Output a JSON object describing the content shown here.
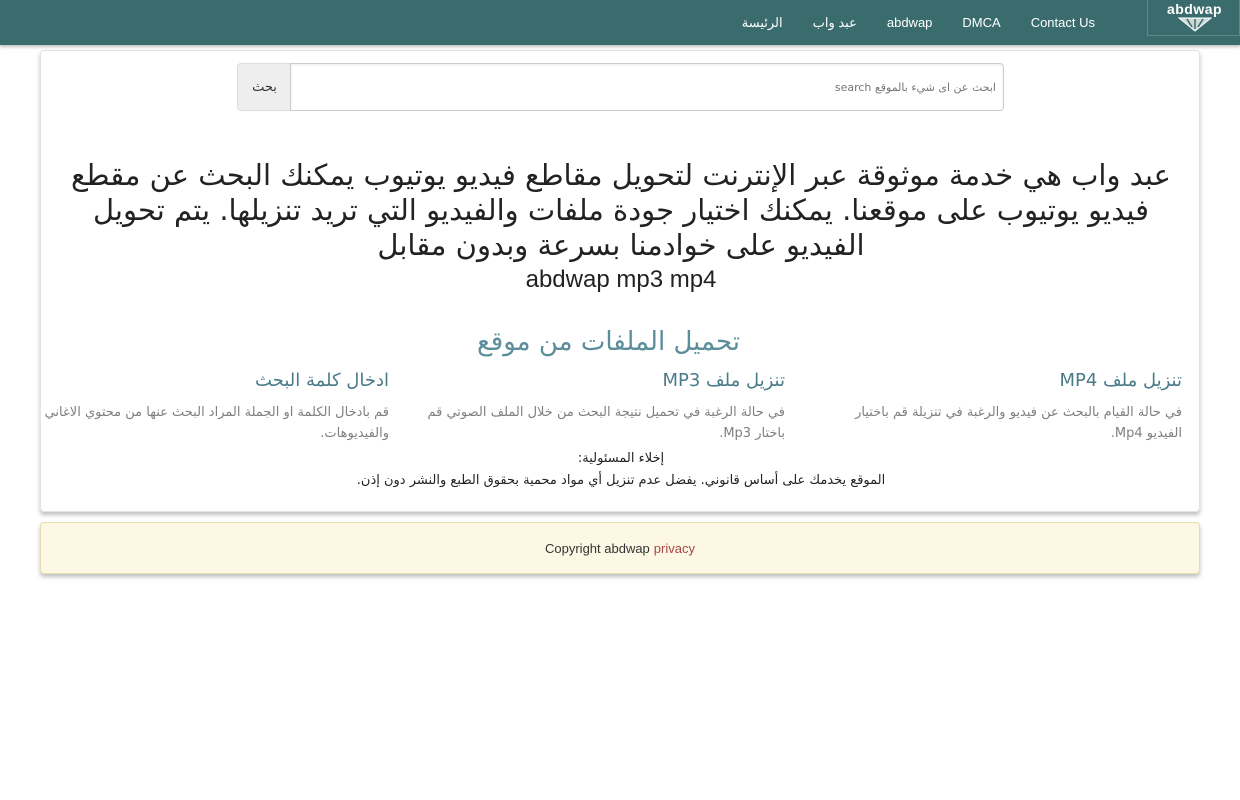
{
  "nav": {
    "logo_text": "abdwap",
    "links": [
      "الرئيسة",
      "عبد واب",
      "abdwap",
      "DMCA",
      "Contact Us"
    ]
  },
  "search": {
    "button_label": "بحث",
    "placeholder": "ابحث عن اى شيء بالموقع search"
  },
  "hero": {
    "text": "عبد واب هي خدمة موثوقة عبر الإنترنت لتحويل مقاطع فيديو يوتيوب يمكنك البحث عن مقطع فيديو يوتيوب على موقعنا. يمكنك اختيار جودة ملفات والفيديو التي تريد تنزيلها. يتم تحويل الفيديو على خوادمنا بسرعة وبدون مقابل",
    "subtitle": "abdwap mp3 mp4"
  },
  "section_title": "تحميل الملفات من موقع",
  "features": [
    {
      "title": "تنزيل ملف MP4",
      "text": "في حالة القيام بالبحث عن فيديو والرغبة في تنزيلة قم باختيار الفيديو Mp4."
    },
    {
      "title": "تنزيل ملف MP3",
      "text": "في حالة الرغبة في تحميل نتيجة البحث من خلال الملف الصوتي قم باختار Mp3."
    },
    {
      "title": "ادخال كلمة البحث",
      "text": "قم بادخال الكلمة او الجملة المراد البحث عنها من محتوي الاغاني والفيديوهات."
    }
  ],
  "disclaimer": {
    "title": "إخلاء المسئولية:",
    "text": "الموقع يخدمك على أساس قانوني. يفضل عدم تنزيل أي مواد محمية بحقوق الطبع والنشر دون إذن."
  },
  "footer": {
    "copyright": "Copyright abdwap",
    "privacy_label": "privacy"
  },
  "colors": {
    "navbar": "#3a6b6d",
    "section_title": "#5b8d9a",
    "feature_title": "#4a7b89",
    "footer_bg": "#fcf8e3",
    "privacy_link": "#a94442"
  }
}
